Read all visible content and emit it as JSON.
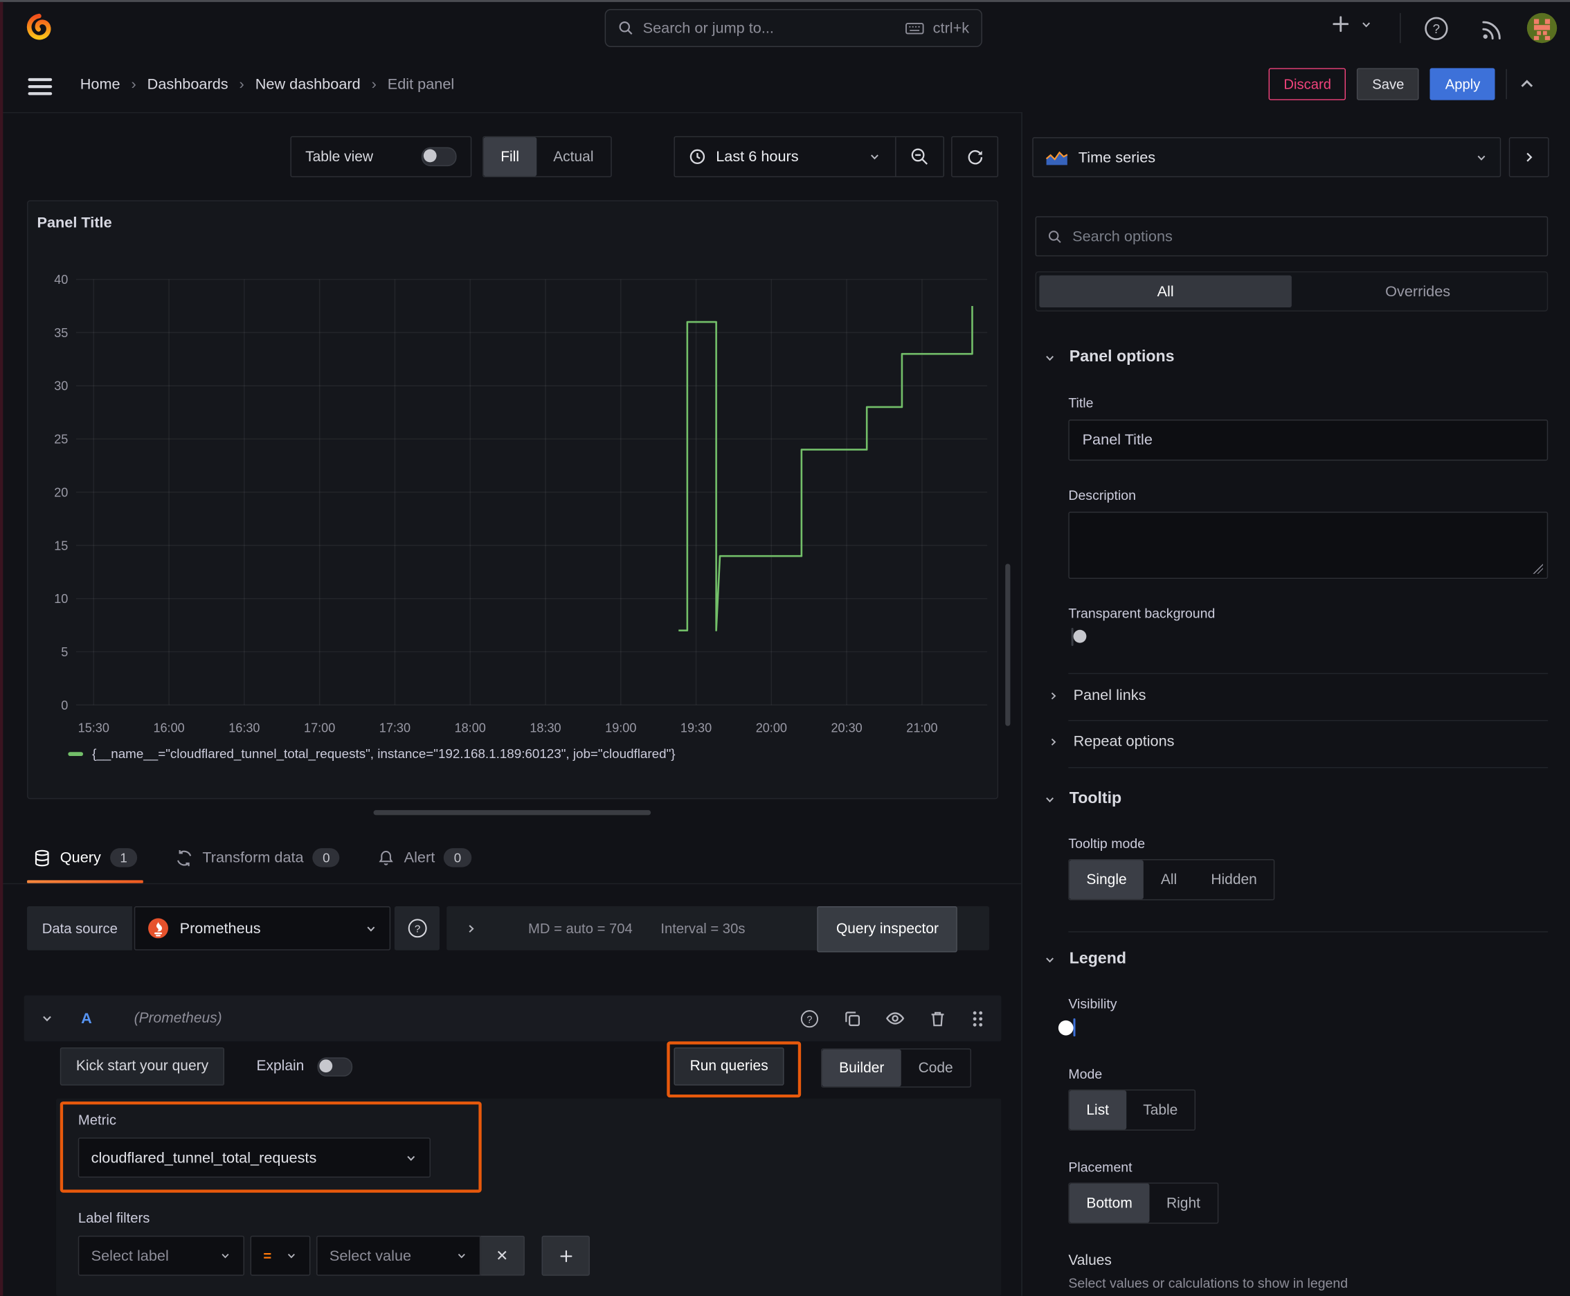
{
  "topnav": {
    "search": {
      "placeholder": "Search or jump to...",
      "shortcut": "ctrl+k"
    }
  },
  "breadcrumb": {
    "items": [
      "Home",
      "Dashboards",
      "New dashboard",
      "Edit panel"
    ]
  },
  "header_actions": {
    "discard": "Discard",
    "save": "Save",
    "apply": "Apply"
  },
  "toolbar": {
    "table_view": "Table view",
    "view_modes": [
      "Fill",
      "Actual"
    ],
    "active_view_mode": "Fill",
    "time_range": "Last 6 hours"
  },
  "panel": {
    "title": "Panel Title"
  },
  "chart_data": {
    "type": "line",
    "title": "Panel Title",
    "x_ticks": [
      "15:30",
      "16:00",
      "16:30",
      "17:00",
      "17:30",
      "18:00",
      "18:30",
      "19:00",
      "19:30",
      "20:00",
      "20:30",
      "21:00"
    ],
    "x_tick_minutes": [
      0,
      30,
      60,
      90,
      120,
      150,
      180,
      210,
      240,
      270,
      300,
      330
    ],
    "y_ticks": [
      0,
      5,
      10,
      15,
      20,
      25,
      30,
      35,
      40
    ],
    "ylim": [
      0,
      40
    ],
    "x_domain_minutes": [
      -7,
      356
    ],
    "grid": true,
    "legend_position": "bottom",
    "series": [
      {
        "name": "{__name__=\"cloudflared_tunnel_total_requests\", instance=\"192.168.1.189:60123\", job=\"cloudflared\"}",
        "color": "#73bf69",
        "points_time_value": [
          [
            233,
            7
          ],
          [
            236.5,
            7
          ],
          [
            236.5,
            36
          ],
          [
            248,
            36
          ],
          [
            248,
            7
          ],
          [
            249.5,
            14
          ],
          [
            282,
            14
          ],
          [
            282,
            24
          ],
          [
            308,
            24
          ],
          [
            308,
            28
          ],
          [
            322,
            28
          ],
          [
            322,
            33
          ],
          [
            350,
            33
          ],
          [
            350,
            37.5
          ]
        ]
      }
    ]
  },
  "tabs": [
    {
      "label": "Query",
      "count": "1"
    },
    {
      "label": "Transform data",
      "count": "0"
    },
    {
      "label": "Alert",
      "count": "0"
    }
  ],
  "query": {
    "datasource_label": "Data source",
    "datasource": "Prometheus",
    "stats_md": "MD = auto = 704",
    "stats_interval": "Interval = 30s",
    "inspector": "Query inspector",
    "ref_id": "A",
    "ref_note": "(Prometheus)",
    "kickstart": "Kick start your query",
    "explain": "Explain",
    "run_queries": "Run queries",
    "editor_modes": [
      "Builder",
      "Code"
    ],
    "active_editor_mode": "Builder",
    "metric_label": "Metric",
    "metric": "cloudflared_tunnel_total_requests",
    "label_filters": "Label filters",
    "select_label_placeholder": "Select label",
    "operator": "=",
    "select_value_placeholder": "Select value"
  },
  "options_pane": {
    "visualization": "Time series",
    "search_placeholder": "Search options",
    "tabs": [
      "All",
      "Overrides"
    ],
    "active_tab": "All",
    "panel_options": {
      "heading": "Panel options",
      "title_label": "Title",
      "title_value": "Panel Title",
      "description_label": "Description",
      "transparent_label": "Transparent background",
      "panel_links": "Panel links",
      "repeat_options": "Repeat options"
    },
    "tooltip": {
      "heading": "Tooltip",
      "mode_label": "Tooltip mode",
      "modes": [
        "Single",
        "All",
        "Hidden"
      ],
      "active_mode": "Single"
    },
    "legend": {
      "heading": "Legend",
      "visibility_label": "Visibility",
      "visibility_on": true,
      "mode_label": "Mode",
      "modes": [
        "List",
        "Table"
      ],
      "active_mode": "List",
      "placement_label": "Placement",
      "placements": [
        "Bottom",
        "Right"
      ],
      "active_placement": "Bottom",
      "values_label": "Values",
      "values_help": "Select values or calculations to show in legend"
    }
  },
  "ui_annotations": {
    "highlight_color": "#e8590c",
    "highlighted": [
      "run-queries-button",
      "metric-select"
    ]
  },
  "colors": {
    "accent_orange": "#ff780a",
    "series_green": "#73bf69",
    "apply_blue": "#3d71d9",
    "discard_pink": "#f1437c"
  }
}
